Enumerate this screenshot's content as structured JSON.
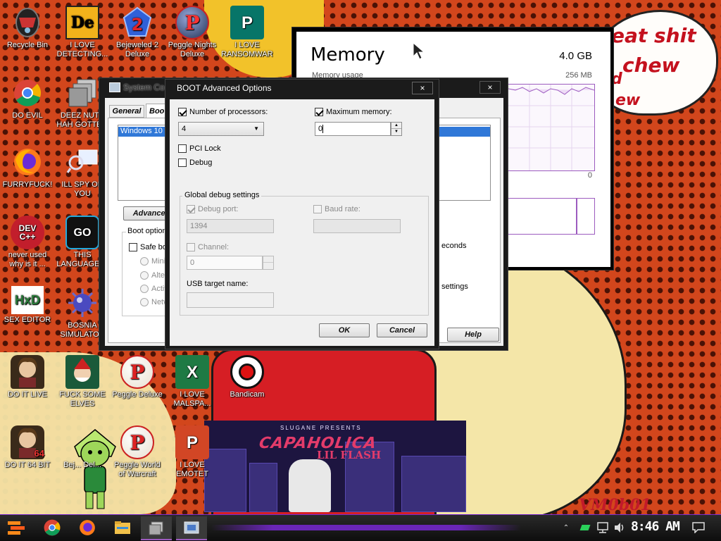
{
  "desktop": {
    "icons": [
      {
        "label": "Recycle Bin",
        "glyph": "",
        "icon": "recycle-bin-icon"
      },
      {
        "label": "I LOVE DETECTING...",
        "glyph": "De",
        "icon": "detect-it-easy-icon"
      },
      {
        "label": "Bejeweled 2 Deluxe",
        "glyph": "2",
        "icon": "bejeweled-icon"
      },
      {
        "label": "Peggle Nights Deluxe",
        "glyph": "P",
        "icon": "peggle-nights-icon"
      },
      {
        "label": "I LOVE RANSOMWARE",
        "glyph": "P",
        "icon": "publisher-icon"
      },
      {
        "label": "DO EVIL",
        "glyph": "",
        "icon": "chrome-icon"
      },
      {
        "label": "DEEZ NUTS HAH GOTTEM",
        "glyph": "",
        "icon": "window-stack-icon"
      },
      {
        "label": "FURRYFUCK!",
        "glyph": "",
        "icon": "firefox-icon"
      },
      {
        "label": "ILL SPY ON YOU",
        "glyph": "",
        "icon": "spy-icon"
      },
      {
        "label": "never used why is it ...",
        "glyph": "DEV C++",
        "icon": "dev-cpp-icon"
      },
      {
        "label": "THIS LANGUAGE ...",
        "glyph": "GO",
        "icon": "golang-icon"
      },
      {
        "label": "SEX EDITOR",
        "glyph": "HxD",
        "icon": "hxd-icon"
      },
      {
        "label": "BOSNIA SIMULATOR",
        "glyph": "",
        "icon": "mine-icon"
      },
      {
        "label": "DO IT LIVE",
        "glyph": "",
        "icon": "portrait-icon"
      },
      {
        "label": "FUCK SOME ELVES",
        "glyph": "",
        "icon": "elf-game-icon"
      },
      {
        "label": "Peggle Deluxe",
        "glyph": "P",
        "icon": "peggle-icon"
      },
      {
        "label": "I LOVE MALSPA...",
        "glyph": "X",
        "icon": "excel-icon"
      },
      {
        "label": "Bandicam",
        "glyph": "",
        "icon": "bandicam-icon"
      },
      {
        "label": "DO IT 64 BIT",
        "glyph": "64",
        "icon": "portrait-64-icon"
      },
      {
        "label": "Bej... Del...",
        "glyph": "",
        "icon": "bejeweled-partial-icon"
      },
      {
        "label": "Peggle World of Warcraft Edition",
        "glyph": "P",
        "icon": "peggle-wow-icon"
      },
      {
        "label": "I LOVE EMOTET",
        "glyph": "P",
        "icon": "powerpoint-icon"
      }
    ]
  },
  "wallpaper": {
    "bubble_lines": [
      "eat shit",
      "chew",
      "d",
      "ew"
    ],
    "album_title": "CAPAHOLICA",
    "album_sub": "LIL FLASH",
    "album_top": "SLUGANE PRESENTS",
    "watermark": "VM0b01"
  },
  "task_manager": {
    "title": "Memory",
    "total": "4.0 GB",
    "usage_label": "Memory usage",
    "usage_value": "256 MB",
    "graph_bottom": "0"
  },
  "msconfig": {
    "title": "System Configuration",
    "title_visible": "System Co",
    "close": "×",
    "tabs": [
      "General",
      "Boot"
    ],
    "os_entry": "Windows 10 (",
    "advanced_btn": "Advanced",
    "boot_options_label": "Boot options",
    "safe_boot": "Safe bo",
    "radios": [
      "Minin",
      "Alter",
      "Activ",
      "Netw"
    ],
    "right_seconds": "econds",
    "right_settings": "settings",
    "help_btn": "Help"
  },
  "boot_advanced": {
    "title": "BOOT Advanced Options",
    "close": "×",
    "num_processors": {
      "label": "Number of processors:",
      "checked": true,
      "value": "4"
    },
    "max_memory": {
      "label": "Maximum memory:",
      "checked": true,
      "value": "0"
    },
    "pci_lock": {
      "label": "PCI Lock",
      "checked": false
    },
    "debug": {
      "label": "Debug",
      "checked": false
    },
    "global_debug_label": "Global debug settings",
    "debug_port": {
      "label": "Debug port:",
      "checked": true,
      "value": "1394"
    },
    "baud_rate": {
      "label": "Baud rate:",
      "checked": false,
      "value": ""
    },
    "channel": {
      "label": "Channel:",
      "checked": false,
      "value": "0"
    },
    "usb_target": {
      "label": "USB target name:",
      "value": ""
    },
    "ok": "OK",
    "cancel": "Cancel"
  },
  "taskbar": {
    "time": "8:46 AM",
    "apps": [
      "chrome-taskbar-icon",
      "firefox-taskbar-icon",
      "explorer-taskbar-icon",
      "window-switch-taskbar-icon",
      "msconfig-taskbar-icon"
    ]
  },
  "colors": {
    "accent": "#7a2bd0",
    "wallpaper": "#d2461c",
    "bubble_text": "#c4111e"
  }
}
